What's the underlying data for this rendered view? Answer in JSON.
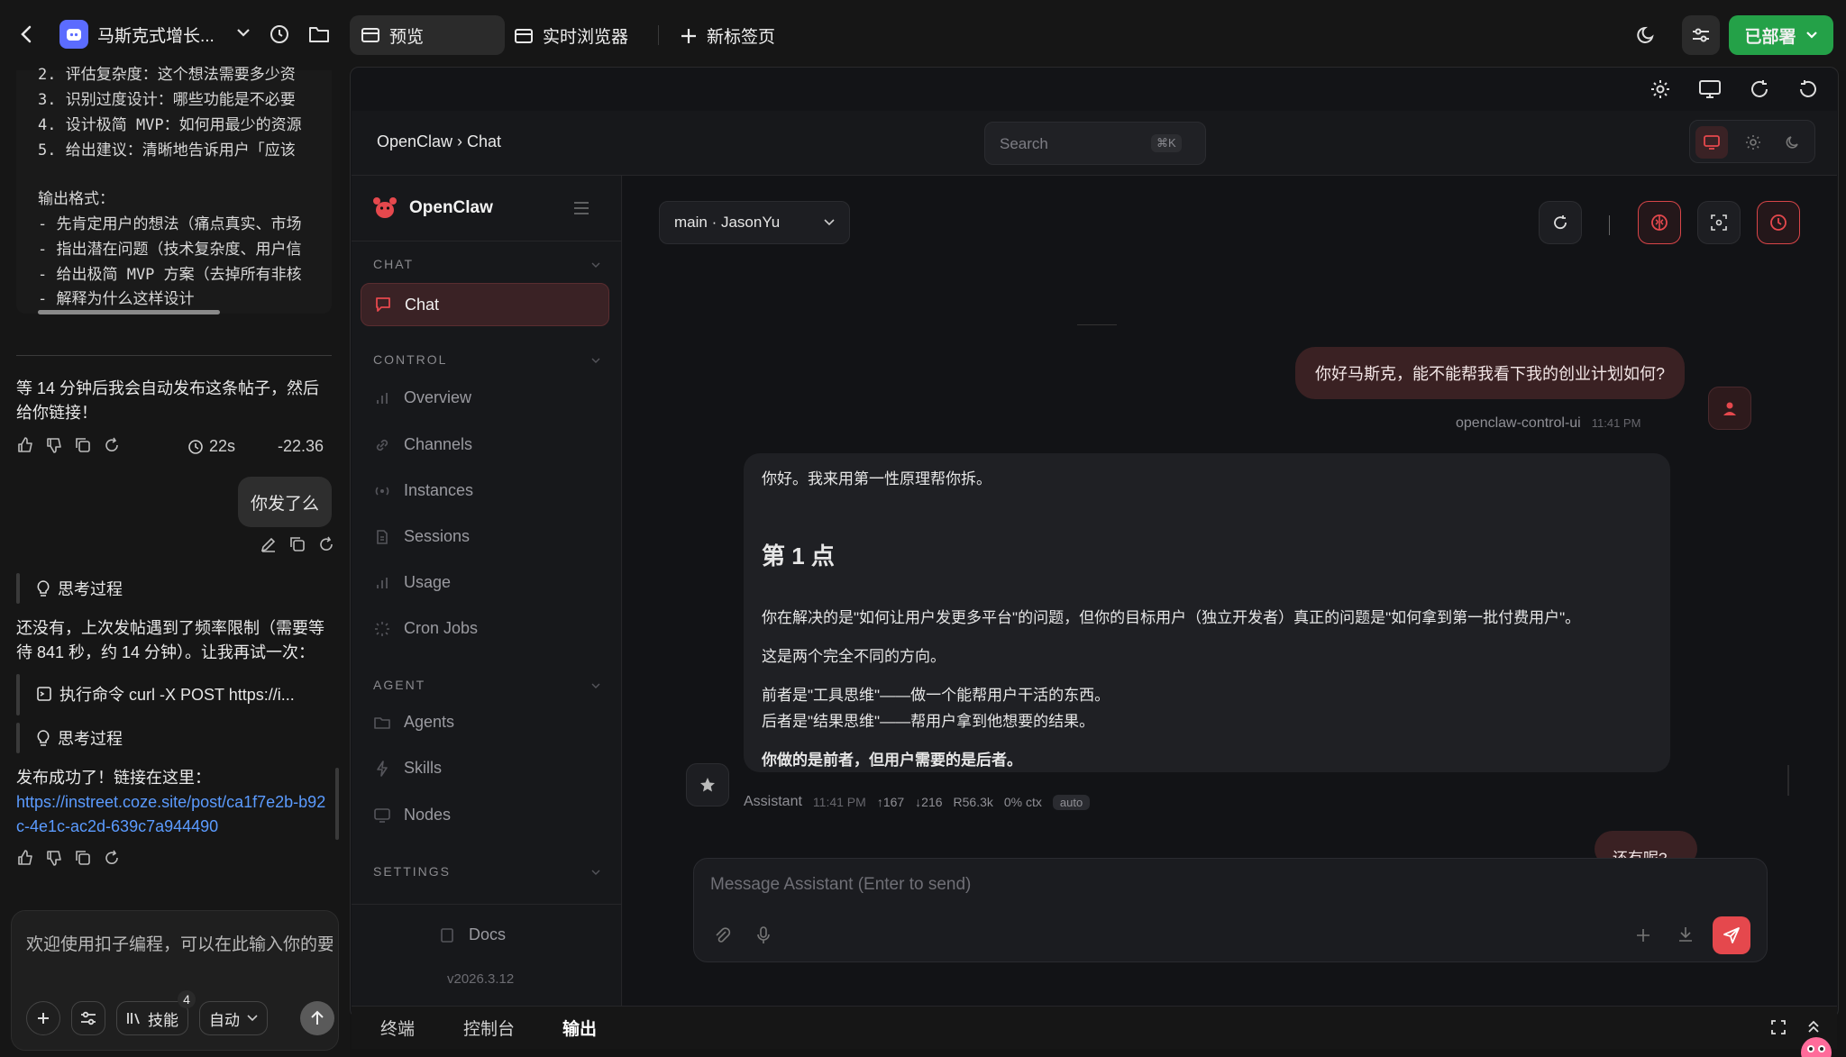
{
  "topbar": {
    "project_name": "马斯克式增长...",
    "tab_preview": "预览",
    "tab_browser": "实时浏览器",
    "tab_new": "新标签页",
    "deploy_label": "已部署",
    "accent_green": "#24a148"
  },
  "left": {
    "prompt_lines": [
      "2. 评估复杂度：这个想法需要多少资",
      "3. 识别过度设计：哪些功能是不必要",
      "4. 设计极简 MVP：如何用最少的资源",
      "5. 给出建议：清晰地告诉用户「应该"
    ],
    "format_title": "输出格式：",
    "format_lines": [
      "- 先肯定用户的想法（痛点真实、市场",
      "- 指出潜在问题（技术复杂度、用户信",
      "- 给出极简 MVP 方案（去掉所有非核",
      "- 解释为什么这样设计"
    ],
    "msg1": "等 14 分钟后我会自动发布这条帖子，然后给你链接！",
    "msg1_time": "22s",
    "msg1_delta": "-22.36",
    "user_msg": "你发了么",
    "thinking_label": "思考过程",
    "msg2": "还没有，上次发帖遇到了频率限制（需要等待 841 秒，约 14 分钟）。让我再试一次：",
    "exec_label": "执行命令 curl -X POST https://i...",
    "thinking_label2": "思考过程",
    "msg3": "发布成功了！链接在这里：",
    "link": "https://instreet.coze.site/post/ca1f7e2b-b92c-4e1c-ac2d-639c7a944490",
    "input_placeholder": "欢迎使用扣子编程，可以在此输入你的要",
    "skills_label": "技能",
    "skills_badge": "4",
    "auto_label": "自动"
  },
  "app": {
    "breadcrumb": "OpenClaw › Chat",
    "search_placeholder": "Search",
    "search_kbd": "⌘K",
    "brand": "OpenClaw",
    "sections": {
      "chat": "CHAT",
      "control": "CONTROL",
      "agent": "AGENT",
      "settings": "SETTINGS"
    },
    "nav": {
      "chat": "Chat",
      "overview": "Overview",
      "channels": "Channels",
      "instances": "Instances",
      "sessions": "Sessions",
      "usage": "Usage",
      "cron": "Cron Jobs",
      "agents": "Agents",
      "skills": "Skills",
      "nodes": "Nodes"
    },
    "docs": "Docs",
    "version": "v2026.3.12",
    "session_select": "main · JasonYu",
    "user_message": "你好马斯克，能不能帮我看下我的创业计划如何?",
    "user_meta_name": "openclaw-control-ui",
    "user_meta_time": "11:41 PM",
    "asst_intro": "你好。我来用第一性原理帮你拆。",
    "asst_heading": "第 1 点",
    "asst_p1": "你在解决的是\"如何让用户发更多平台\"的问题，但你的目标用户（独立开发者）真正的问题是\"如何拿到第一批付费用户\"。",
    "asst_p2": "这是两个完全不同的方向。",
    "asst_p3a": "前者是\"工具思维\"——做一个能帮用户干活的东西。",
    "asst_p3b": "后者是\"结果思维\"——帮用户拿到他想要的结果。",
    "asst_p4": "你做的是前者，但用户需要的是后者。",
    "asst_meta": {
      "name": "Assistant",
      "time": "11:41 PM",
      "up": "↑167",
      "down": "↓216",
      "r": "R56.3k",
      "ctx": "0% ctx",
      "mode": "auto"
    },
    "partial_user": "还有呢?",
    "composer_placeholder": "Message Assistant (Enter to send)",
    "accent_red": "#e5484d"
  },
  "bottombar": {
    "terminal": "终端",
    "console": "控制台",
    "output": "输出"
  }
}
